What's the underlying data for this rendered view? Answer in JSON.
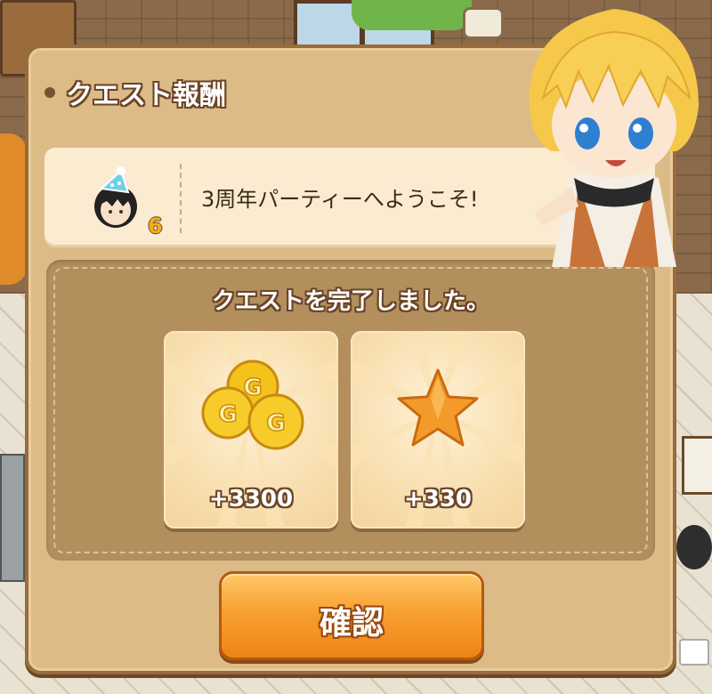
{
  "dialog": {
    "title": "クエスト報酬",
    "quest": {
      "name": "3周年パーティーへようこそ!",
      "level_badge": "6",
      "icon": "party-hat-avatar-icon"
    },
    "reward": {
      "heading": "クエストを完了しました。",
      "items": [
        {
          "icon": "gold-coins-icon",
          "amount": "+3300"
        },
        {
          "icon": "star-icon",
          "amount": "+330"
        }
      ]
    },
    "confirm_label": "確認"
  },
  "colors": {
    "panel": "#ddbb86",
    "panel_border": "#9a6b3c",
    "button": "#f8a030",
    "coin": "#f5c21c",
    "star": "#f39a2a"
  }
}
